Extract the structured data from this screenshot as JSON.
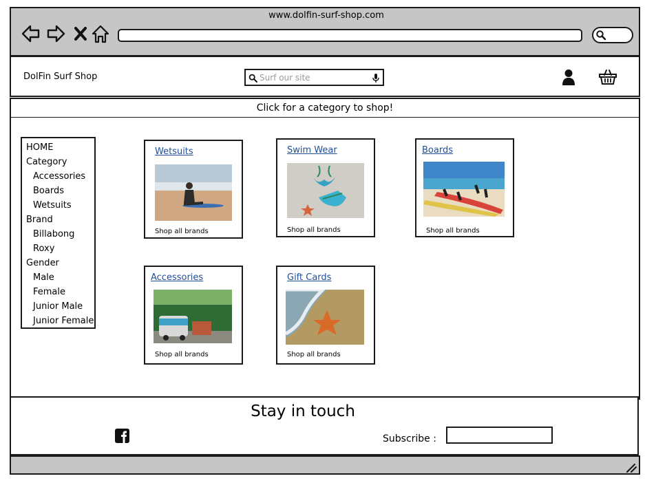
{
  "browser": {
    "url": "www.dolfin-surf-shop.com",
    "nav_icons": [
      "back-arrow-icon",
      "forward-arrow-icon",
      "close-x-icon",
      "home-icon",
      "search-icon"
    ]
  },
  "header": {
    "shop_name": "DolFin Surf Shop",
    "search": {
      "placeholder": "Surf our site",
      "value": ""
    },
    "icons": [
      "user-icon",
      "shopping-basket-icon",
      "microphone-icon"
    ]
  },
  "banner": {
    "text": "Click for a category to shop!"
  },
  "sidebar": {
    "items": [
      {
        "label": "HOME",
        "level": 0
      },
      {
        "label": "Category",
        "level": 0
      },
      {
        "label": "Accessories",
        "level": 1
      },
      {
        "label": "Boards",
        "level": 1
      },
      {
        "label": "Wetsuits",
        "level": 1
      },
      {
        "label": "Brand",
        "level": 0
      },
      {
        "label": "Billabong",
        "level": 1
      },
      {
        "label": "Roxy",
        "level": 1
      },
      {
        "label": "Gender",
        "level": 0
      },
      {
        "label": "Male",
        "level": 1
      },
      {
        "label": "Female",
        "level": 1
      },
      {
        "label": "Junior Male",
        "level": 1
      },
      {
        "label": "Junior Female",
        "level": 1
      }
    ]
  },
  "categories": [
    {
      "title": "Wetsuits",
      "footer": "Shop all brands"
    },
    {
      "title": "Swim Wear",
      "footer": "Shop all brands"
    },
    {
      "title": "Boards",
      "footer": "Shop all brands"
    },
    {
      "title": "Accessories",
      "footer": "Shop all brands"
    },
    {
      "title": "Gift Cards",
      "footer": "Shop all brands"
    }
  ],
  "footer": {
    "title": "Stay in touch",
    "subscribe_label": "Subscribe :",
    "subscribe_value": "",
    "social_icons": [
      "facebook-icon"
    ]
  },
  "colors": {
    "chrome_gray": "#c6c6c6",
    "link_blue": "#1f4e99",
    "border": "#1a1a1a"
  }
}
